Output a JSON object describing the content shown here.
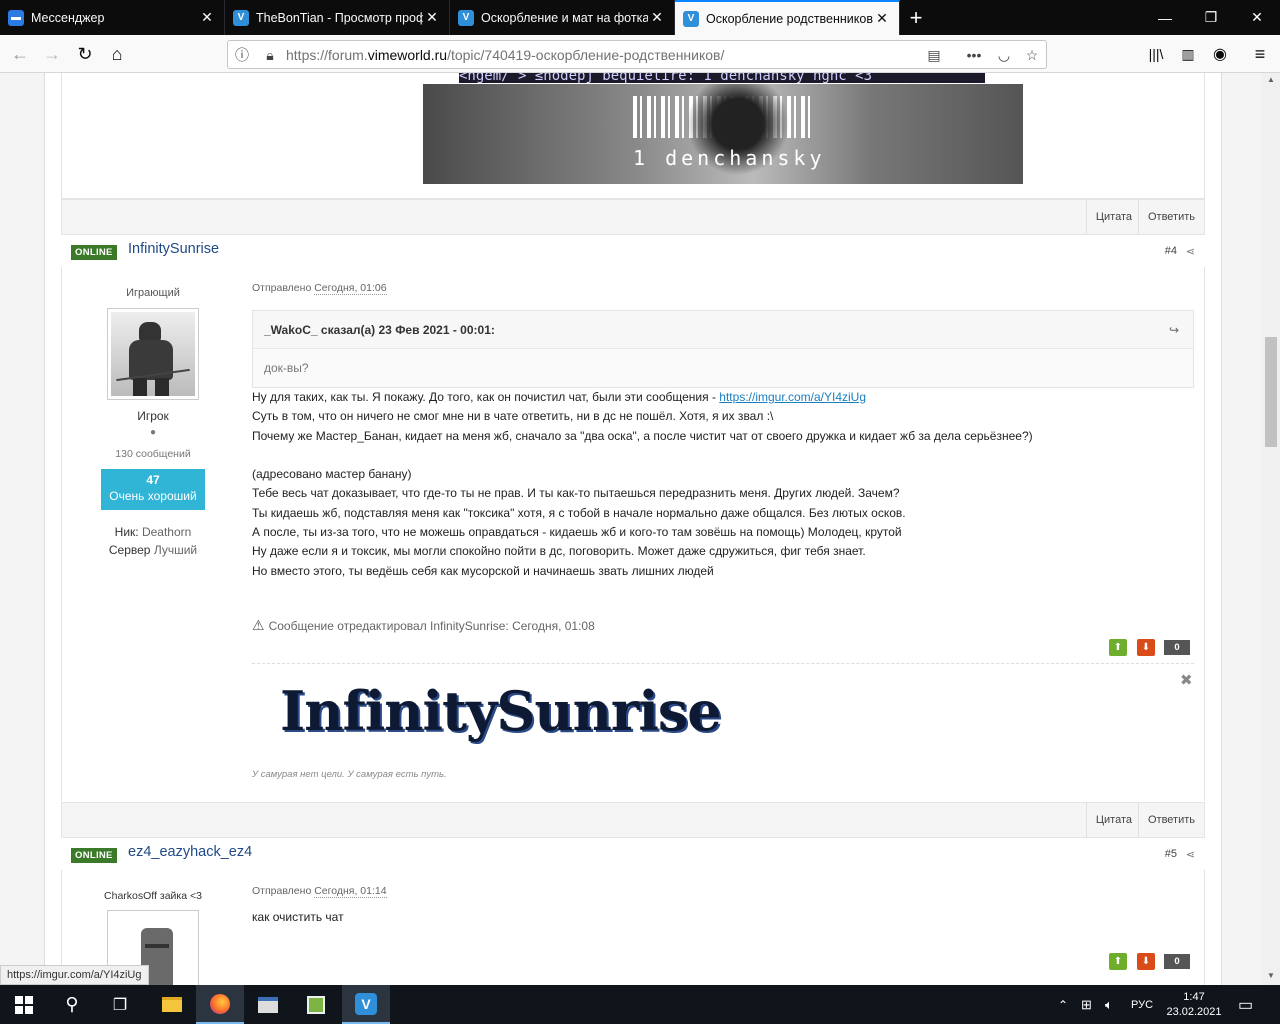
{
  "browser": {
    "tabs": [
      {
        "title": "Мессенджер",
        "icon": "messenger-icon",
        "color": "#2a7be4",
        "active": false
      },
      {
        "title": "TheBonTian - Просмотр профиля",
        "icon": "vimeworld-icon",
        "color": "#2f8fd8",
        "active": false
      },
      {
        "title": "Оскорбление и мат на фотках",
        "icon": "vimeworld-icon",
        "color": "#2f8fd8",
        "active": false
      },
      {
        "title": "Оскорбление родственников",
        "icon": "vimeworld-icon",
        "color": "#2f8fd8",
        "active": true
      }
    ],
    "url_prefix": "https://forum.",
    "url_domain": "vimeworld.ru",
    "url_path": "/topic/740419-оскорбление-родственников/"
  },
  "page": {
    "banner_text": "1 denchansky",
    "banner_top_text": "<ngem/ > ≤nodepj bequietire: 1_denchansky ngnc <3",
    "actions": {
      "quote": "Цитата",
      "reply": "Ответить"
    },
    "posts": [
      {
        "status": "ONLINE",
        "author": "InfinitySunrise",
        "number": "#4",
        "group_title": "Играющий",
        "rank": "Игрок",
        "message_count": "130 сообщений",
        "reputation_value": "47",
        "reputation_label": "Очень хороший",
        "nick_label": "Ник:",
        "nick": "Deathorn",
        "server_label": "Сервер",
        "server": "Лучший",
        "posted_label": "Отправлено",
        "posted_time": "Сегодня, 01:06",
        "quote_header": "_WakoC_ сказал(а) 23 Фев 2021 - 00:01:",
        "quote_body": "док-вы?",
        "line1_text": "Ну для таких, как ты. Я покажу. До того, как он почистил чат, были эти сообщения - ",
        "line1_link": "https://imgur.com/a/YI4ziUg",
        "lines": [
          "Суть в том, что он ничего не смог мне ни в чате ответить, ни в дс не пошёл. Хотя, я их звал :\\",
          "Почему же Мастер_Банан, кидает на меня жб, сначало за \"два оска\", а после чистит чат от своего дружка и кидает жб за дела серьёзнее?)",
          "",
          "(адресовано мастер банану)",
          "Тебе весь чат доказывает, что где-то ты не прав. И ты как-то пытаешься передразнить меня. Других людей. Зачем?",
          "Ты кидаешь жб, подставляя меня как \"токсика\" хотя, я с тобой в начале нормально даже общался. Без лютых осков.",
          "А после, ты из-за того, что не можешь оправдаться - кидаешь жб и кого-то там зовёшь на помощь) Молодец, крутой",
          "Ну даже если я и токсик, мы могли спокойно пойти в дс, поговорить. Может даже сдружиться, фиг тебя знает.",
          "Но вместо этого, ты ведёшь себя как мусорской и начинаешь звать лишних людей"
        ],
        "edited_note": "Сообщение отредактировал InfinitySunrise: Сегодня, 01:08",
        "votes": "0",
        "signature_image_text": "InfinitySunrise",
        "signature_text": "У самурая нет цели. У самурая есть путь."
      },
      {
        "status": "ONLINE",
        "author": "ez4_eazyhack_ez4",
        "number": "#5",
        "group_title": "CharkosOff зайка <3",
        "posted_label": "Отправлено",
        "posted_time": "Сегодня, 01:14",
        "body": "как очистить чат",
        "votes": "0"
      }
    ],
    "status_url": "https://imgur.com/a/YI4ziUg"
  },
  "taskbar": {
    "language": "РУС",
    "time": "1:47",
    "date": "23.02.2021"
  }
}
